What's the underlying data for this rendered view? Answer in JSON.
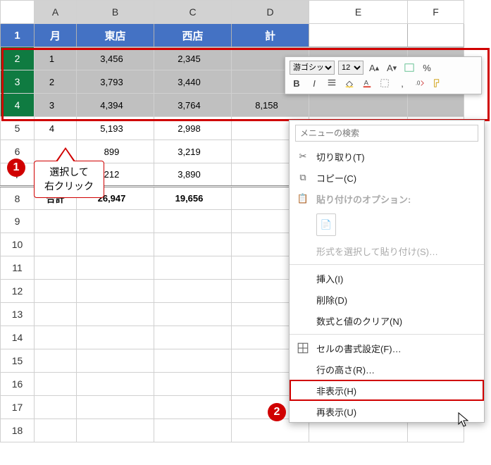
{
  "columns": [
    "A",
    "B",
    "C",
    "D",
    "E",
    "F"
  ],
  "header_row": {
    "a": "月",
    "b": "東店",
    "c": "西店",
    "d": "計"
  },
  "rows": [
    {
      "n": "2",
      "a": "1",
      "b": "3,456",
      "c": "2,345",
      "d": ""
    },
    {
      "n": "3",
      "a": "2",
      "b": "3,793",
      "c": "3,440",
      "d": ""
    },
    {
      "n": "4",
      "a": "3",
      "b": "4,394",
      "c": "3,764",
      "d": "8,158"
    },
    {
      "n": "5",
      "a": "4",
      "b": "5,193",
      "c": "2,998",
      "d": ""
    },
    {
      "n": "6",
      "a": "",
      "b": "899",
      "c": "3,219",
      "d": ""
    },
    {
      "n": "7",
      "a": "",
      "b": "212",
      "c": "3,890",
      "d": ""
    },
    {
      "n": "8",
      "a": "合計",
      "b": "26,947",
      "c": "19,656",
      "d": ""
    }
  ],
  "blank_rows": [
    "9",
    "10",
    "11",
    "12",
    "13",
    "14",
    "15",
    "16",
    "17",
    "18"
  ],
  "callout": {
    "line1": "選択して",
    "line2": "右クリック"
  },
  "badges": {
    "one": "1",
    "two": "2"
  },
  "minitoolbar": {
    "font": "游ゴシック",
    "size": "12",
    "bold": "B",
    "italic": "I"
  },
  "context_menu": {
    "search_placeholder": "メニューの検索",
    "cut": "切り取り(T)",
    "copy": "コピー(C)",
    "paste_opts": "貼り付けのオプション:",
    "paste_special": "形式を選択して貼り付け(S)…",
    "insert": "挿入(I)",
    "delete": "削除(D)",
    "clear": "数式と値のクリア(N)",
    "format_cells": "セルの書式設定(F)…",
    "row_height": "行の高さ(R)…",
    "hide": "非表示(H)",
    "unhide": "再表示(U)"
  }
}
